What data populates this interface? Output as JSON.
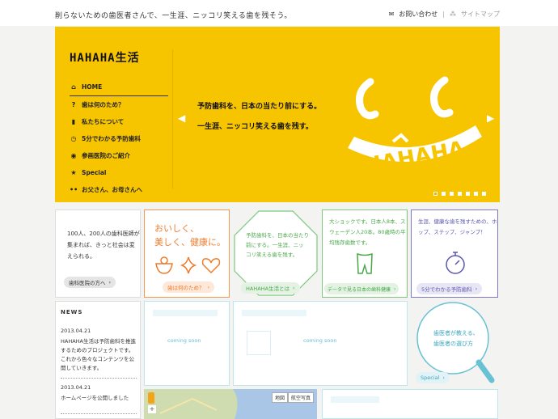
{
  "header": {
    "tagline": "削らないための歯医者さんで、一生涯、ニッコリ笑える歯を残そう。",
    "contact_label": "お問い合わせ",
    "sitemap_label": "サイトマップ"
  },
  "hero": {
    "logo": "HAHAHA生活",
    "nav": [
      {
        "icon": "home-icon",
        "glyph": "⌂",
        "label": "HOME"
      },
      {
        "icon": "question-icon",
        "glyph": "?",
        "label": "歯は何のため？"
      },
      {
        "icon": "speech-icon",
        "glyph": "▮",
        "label": "私たちについて"
      },
      {
        "icon": "clock-icon",
        "glyph": "◷",
        "label": "5分でわかる予防歯科"
      },
      {
        "icon": "hospital-icon",
        "glyph": "◉",
        "label": "参画医院のご紹介"
      },
      {
        "icon": "star-icon",
        "glyph": "★",
        "label": "Special"
      },
      {
        "icon": "family-icon",
        "glyph": "••",
        "label": "お父さん、お母さんへ"
      }
    ],
    "catch_line1": "予防歯科を、日本の当たり前にする。",
    "catch_line2": "一生涯、ニッコリ笑える歯を残す。",
    "face_text": "HAHAHA",
    "slide_count": 7,
    "active_slide": 1
  },
  "cards": {
    "doctors": {
      "text": "100人、200人の歯科医師が集まれば、きっと社会は変えられる。",
      "button": "歯科医院の方へ"
    },
    "tooth_purpose": {
      "text_line1": "おいしく、",
      "text_line2": "美しく、健康に。",
      "button": "歯は何のため？"
    },
    "hahaha_life": {
      "text": "予防歯科を、日本の当たり前にする。一生涯、ニッコリ笑える歯を残す。",
      "button": "HAHAHA生活とは"
    },
    "data": {
      "text": "大ショックです。日本人8本、スウェーデン人20本。80歳時の平均残存歯数です。",
      "button": "データで見る日本の歯科健康"
    },
    "five_minutes": {
      "text": "生涯、健康な歯を残すための、ホップ、ステップ、ジャンプ！",
      "button": "5分でわかる予防歯科"
    }
  },
  "news": {
    "heading": "NEWS",
    "items": [
      {
        "date": "2013.04.21",
        "body": "HAHAHA生活は予防歯科を推進するためのプロジェクトです。これから色々なコンテンツを公開していきます。"
      },
      {
        "date": "2013.04.21",
        "body": "ホームページを公開しました"
      }
    ]
  },
  "coming_soon": {
    "label": "coming soon"
  },
  "special": {
    "line1": "歯医者が教える、",
    "line2": "歯医者の選び方",
    "button": "Special"
  },
  "map": {
    "tab1": "地図",
    "tab2": "航空写真"
  },
  "colors": {
    "yellow": "#f7c500",
    "orange": "#ee7c2a",
    "green": "#4aa84a",
    "purple": "#5a56b0",
    "cyan": "#69c1d4"
  }
}
